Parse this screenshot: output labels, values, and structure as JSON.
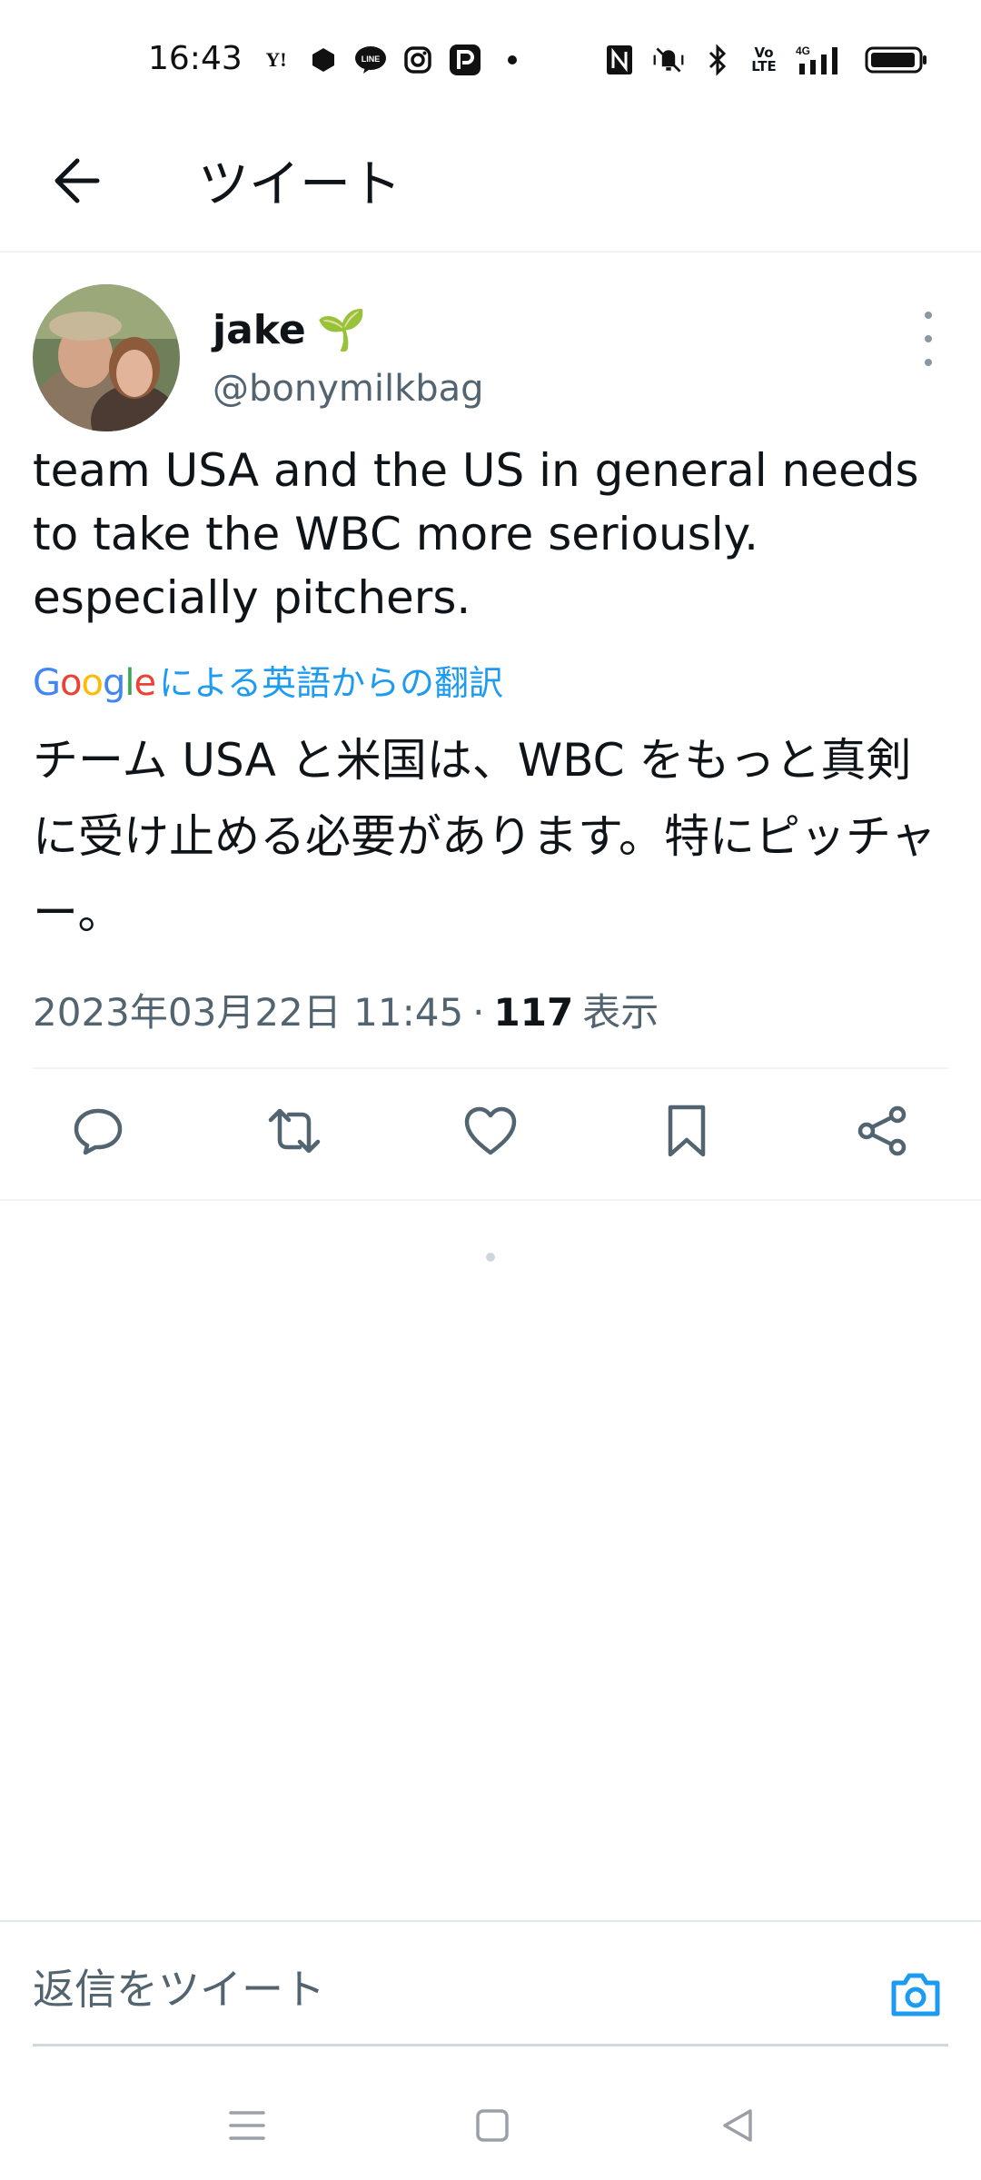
{
  "status_bar": {
    "time": "16:43",
    "left_icons": [
      "yahoo-icon",
      "notification-app-icon",
      "line-icon",
      "instagram-icon",
      "paypay-icon",
      "more-notifications-dot-icon"
    ],
    "right_icons": [
      "nfc-icon",
      "mute-vibrate-icon",
      "bluetooth-icon",
      "volte-icon",
      "4g-signal-icon",
      "battery-icon"
    ],
    "yahoo_label": "Y!",
    "line_label": "LINE",
    "volte_label": "Vo LTE",
    "network_label": "4G"
  },
  "header": {
    "title": "ツイート",
    "back_icon": "arrow-left-icon"
  },
  "tweet": {
    "author_name": "jake",
    "author_emoji": "🌱",
    "author_handle": "@bonymilkbag",
    "text": "team USA and the US in general needs to take the WBC more seriously. especially pitchers.",
    "translation": {
      "google_label": "Google",
      "label": "による英語からの翻訳",
      "text": "チーム USA と米国は、WBC をもっと真剣に受け止める必要があります。特にピッチャー。"
    },
    "timestamp": "2023年03月22日 11:45",
    "separator": "·",
    "views_count": "117",
    "views_label": "表示",
    "actions": [
      "reply-icon",
      "retweet-icon",
      "like-icon",
      "bookmark-icon",
      "share-icon"
    ]
  },
  "reply_bar": {
    "placeholder": "返信をツイート",
    "camera_icon": "camera-icon"
  },
  "nav_bar": {
    "items": [
      "menu-icon",
      "home-square-icon",
      "back-triangle-icon"
    ]
  },
  "colors": {
    "accent": "#1d9bf0",
    "text_primary": "#0f1419",
    "text_secondary": "#536471",
    "divider": "#eff3f4"
  }
}
